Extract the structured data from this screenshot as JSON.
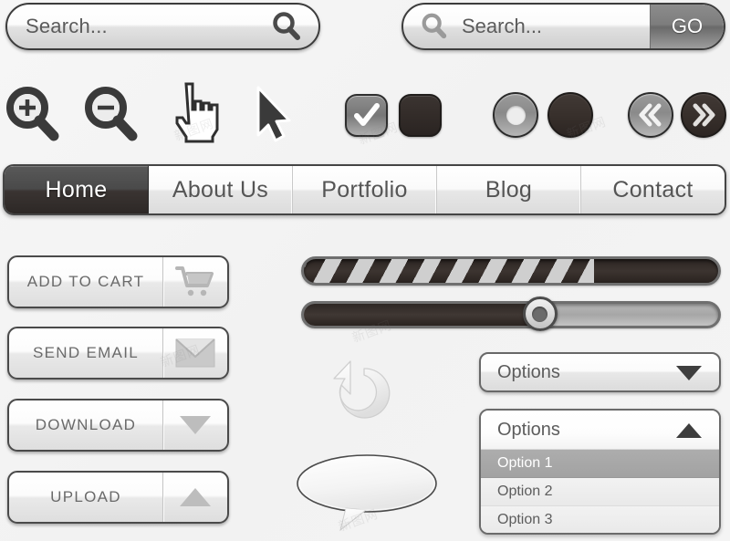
{
  "search_bar_primary": {
    "placeholder": "Search...",
    "icon": "search-icon"
  },
  "search_bar_secondary": {
    "placeholder": "Search...",
    "icon": "search-icon",
    "submit_label": "GO"
  },
  "icon_row": {
    "items": [
      {
        "name": "zoom-in-icon",
        "label": "Zoom In"
      },
      {
        "name": "zoom-out-icon",
        "label": "Zoom Out"
      },
      {
        "name": "hand-pointer-cursor-icon",
        "label": "Hand Cursor"
      },
      {
        "name": "arrow-cursor-icon",
        "label": "Arrow Cursor"
      },
      {
        "name": "checkbox-checked",
        "label": "Checkbox Checked"
      },
      {
        "name": "checkbox-unchecked",
        "label": "Checkbox Unchecked"
      },
      {
        "name": "radio-selected",
        "label": "Radio Selected"
      },
      {
        "name": "radio-unselected",
        "label": "Radio Unselected"
      },
      {
        "name": "prev-double-chevron-icon",
        "label": "Previous"
      },
      {
        "name": "next-double-chevron-icon",
        "label": "Next"
      }
    ]
  },
  "nav": {
    "items": [
      {
        "label": "Home",
        "active": true
      },
      {
        "label": "About Us",
        "active": false
      },
      {
        "label": "Portfolio",
        "active": false
      },
      {
        "label": "Blog",
        "active": false
      },
      {
        "label": "Contact",
        "active": false
      }
    ]
  },
  "action_buttons": [
    {
      "label": "ADD TO CART",
      "icon": "shopping-cart-icon"
    },
    {
      "label": "SEND EMAIL",
      "icon": "envelope-icon"
    },
    {
      "label": "DOWNLOAD",
      "icon": "triangle-down-icon"
    },
    {
      "label": "UPLOAD",
      "icon": "triangle-up-icon"
    }
  ],
  "progress_bar": {
    "value_percent": 70,
    "style": "striped"
  },
  "slider": {
    "value_percent": 57
  },
  "refresh_icon": {
    "name": "refresh-circular-arrow-icon"
  },
  "speech_bubble": {
    "name": "speech-bubble-shape"
  },
  "dropdown_closed": {
    "label": "Options",
    "arrow": "triangle-down-icon",
    "expanded": false
  },
  "dropdown_open": {
    "label": "Options",
    "arrow": "triangle-up-icon",
    "expanded": true,
    "options": [
      {
        "label": "Option 1",
        "selected": true
      },
      {
        "label": "Option 2",
        "selected": false
      },
      {
        "label": "Option 3",
        "selected": false
      }
    ]
  },
  "colors": {
    "background": "#f4f4f4",
    "dark": "#2e2724",
    "mid_gray": "#8a8a8a",
    "text_gray": "#5c5c5c",
    "selected_row": "#a8a8a8",
    "border_dark": "#3c3c3c"
  },
  "watermarks": [
    "新图网",
    "新图网",
    "新图网",
    "新图网",
    "新图网",
    "新图网"
  ]
}
